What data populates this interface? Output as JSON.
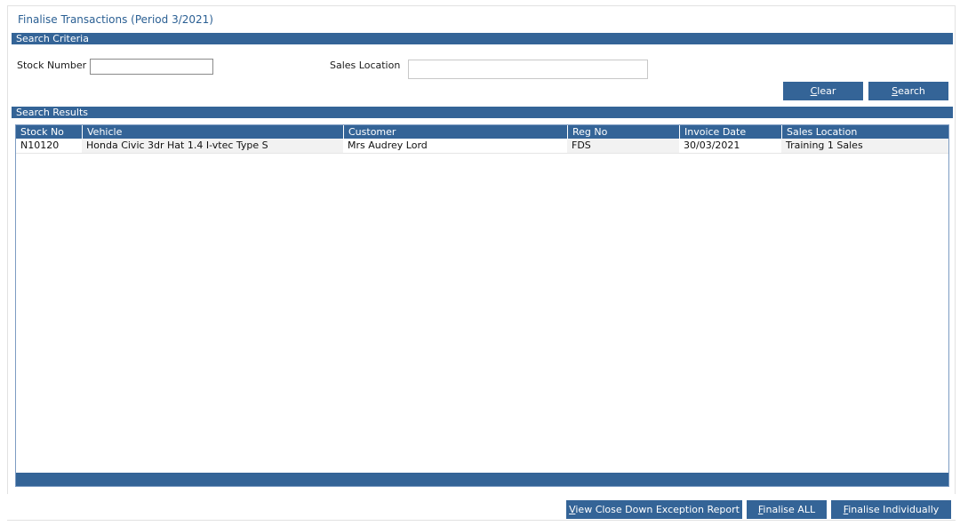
{
  "page": {
    "title": "Finalise Transactions (Period 3/2021)"
  },
  "search_criteria": {
    "header": "Search Criteria",
    "stock_number_label": "Stock Number",
    "stock_number_value": "",
    "sales_location_label": "Sales Location",
    "sales_location_value": "",
    "clear_button": {
      "label": "Clear",
      "accesskey": "C",
      "rest": "lear"
    },
    "search_button": {
      "label": "Search",
      "accesskey": "S",
      "rest": "earch"
    }
  },
  "results": {
    "header": "Search Results",
    "columns": [
      "Stock No",
      "Vehicle",
      "Customer",
      "Reg No",
      "Invoice Date",
      "Sales Location"
    ],
    "rows": [
      {
        "stock_no": "N10120",
        "vehicle": "Honda Civic 3dr Hat 1.4 I-vtec Type S",
        "customer": "Mrs Audrey Lord",
        "reg_no": "FDS",
        "invoice_date": "30/03/2021",
        "sales_location": "Training 1 Sales"
      }
    ]
  },
  "footer_buttons": {
    "view_report": {
      "accesskey": "V",
      "rest": "iew Close Down Exception Report"
    },
    "finalise_all": {
      "accesskey": "F",
      "rest": "inalise ALL"
    },
    "finalise_individually": {
      "accesskey": "F",
      "rest": "inalise Individually"
    }
  },
  "colors": {
    "accent": "#346497",
    "title_text": "#2a5f93"
  }
}
